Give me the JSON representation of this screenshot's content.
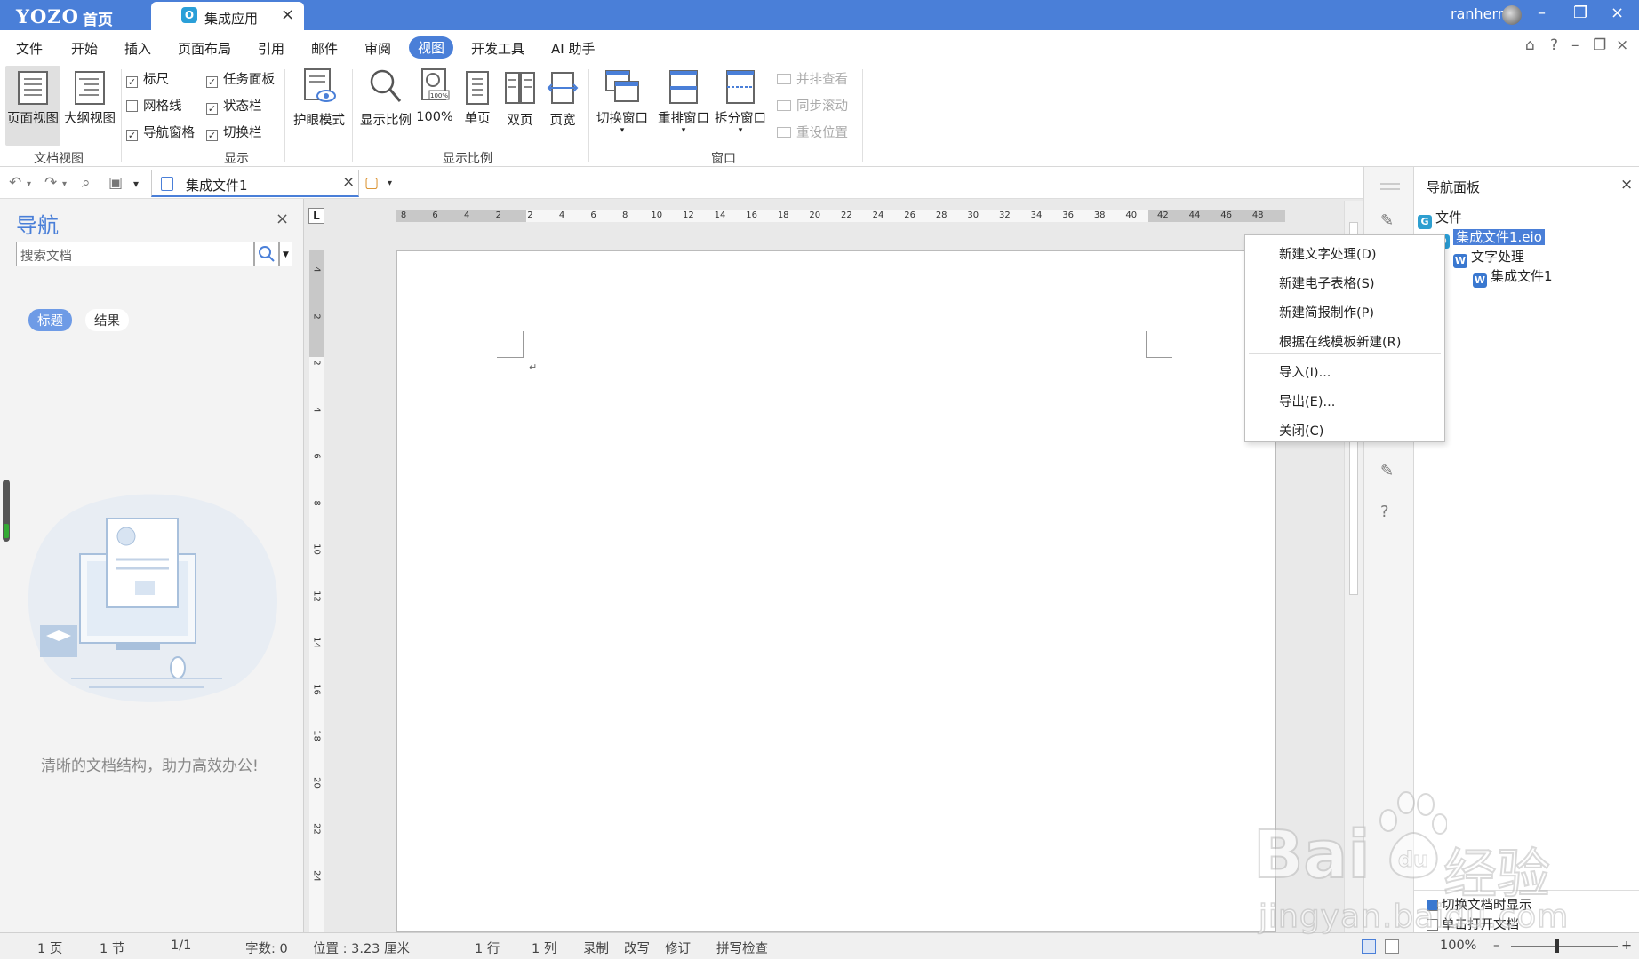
{
  "titlebar": {
    "logo": "YOZO",
    "home": "首页",
    "app_tab": "集成应用",
    "app_tab_icon_letter": "O",
    "user": "ranherr",
    "close_glyph": "×",
    "min_glyph": "–",
    "restore_glyph": "❐"
  },
  "menu": {
    "items": [
      "文件",
      "开始",
      "插入",
      "页面布局",
      "引用",
      "邮件",
      "审阅",
      "视图",
      "开发工具",
      "AI 助手"
    ],
    "active_index": 7,
    "right_icons": [
      "⌂",
      "?",
      "–",
      "❐",
      "×"
    ]
  },
  "ribbon": {
    "doc_view": {
      "page_view": "页面视图",
      "outline_view": "大纲视图",
      "group": "文档视图"
    },
    "show": {
      "ruler": "标尺",
      "task_pane": "任务面板",
      "gridlines": "网格线",
      "status_bar": "状态栏",
      "nav_pane": "导航窗格",
      "switch_bar": "切换栏",
      "group": "显示",
      "check_glyph": "✓"
    },
    "eye_mode": "护眼模式",
    "zoom": {
      "zoom": "显示比例",
      "pct": "100%",
      "single": "单页",
      "double": "双页",
      "page_width": "页宽",
      "group": "显示比例",
      "pct_badge": "100%"
    },
    "window": {
      "switch": "切换窗口",
      "arrange": "重排窗口",
      "split": "拆分窗口",
      "group": "窗口",
      "side_by_side": "并排查看",
      "sync_scroll": "同步滚动",
      "reset_pos": "重设位置",
      "drop": "▾"
    }
  },
  "quickbar": {
    "undo": "↶",
    "redo": "↷",
    "preview": "⌕",
    "save": "▣",
    "more": "▾",
    "doc_tab": "集成文件1",
    "close": "×",
    "new": "▢",
    "new_drop": "▾"
  },
  "navpanel": {
    "title": "导航",
    "close": "×",
    "search_placeholder": "搜索文档",
    "search_drop": "▼",
    "tab_headings": "标题",
    "tab_results": "结果",
    "tagline": "清晰的文档结构，助力高效办公!"
  },
  "ruler": {
    "corner": "L",
    "h_ticks": [
      "8",
      "6",
      "4",
      "2",
      "2",
      "4",
      "6",
      "8",
      "10",
      "12",
      "14",
      "16",
      "18",
      "20",
      "22",
      "24",
      "26",
      "28",
      "30",
      "32",
      "34",
      "36",
      "38",
      "40",
      "42",
      "44",
      "46",
      "48"
    ],
    "v_ticks": [
      "4",
      "2",
      "2",
      "4",
      "6",
      "8",
      "10",
      "12",
      "14",
      "16",
      "18",
      "20",
      "22",
      "24"
    ]
  },
  "document": {
    "para_mark": "↵"
  },
  "context_menu": {
    "items": [
      "新建文字处理(D)",
      "新建电子表格(S)",
      "新建简报制作(P)",
      "根据在线模板新建(R)",
      "导入(I)...",
      "导出(E)...",
      "关闭(C)"
    ]
  },
  "rtool": {
    "icons": [
      "✎",
      "✎",
      "?"
    ]
  },
  "rpanel": {
    "title": "导航面板",
    "close": "×",
    "tree": [
      {
        "label": "文件",
        "icon": "G"
      },
      {
        "label": "集成文件1.eio",
        "icon": "O"
      },
      {
        "label": "文字处理",
        "icon": "W"
      },
      {
        "label": "集成文件1",
        "icon": "W"
      }
    ],
    "opt_switch": "切换文档时显示",
    "opt_single_click": "单击打开文档"
  },
  "statusbar": {
    "page": "1 页",
    "section": "1 节",
    "pages": "1/1",
    "words": "字数: 0",
    "position": "位置 : 3.23 厘米",
    "line": "1 行",
    "col": "1 列",
    "record": "录制",
    "overwrite": "改写",
    "revise": "修订",
    "spell": "拼写检查",
    "zoom": "100%",
    "minus": "–",
    "plus": "+"
  },
  "watermark": {
    "brand": "Bai",
    "brand_cn": "经验",
    "url": "jingyan.baidu.com"
  },
  "colors": {
    "accent": "#4a7fd8",
    "titlebar": "#4a7fd8"
  }
}
